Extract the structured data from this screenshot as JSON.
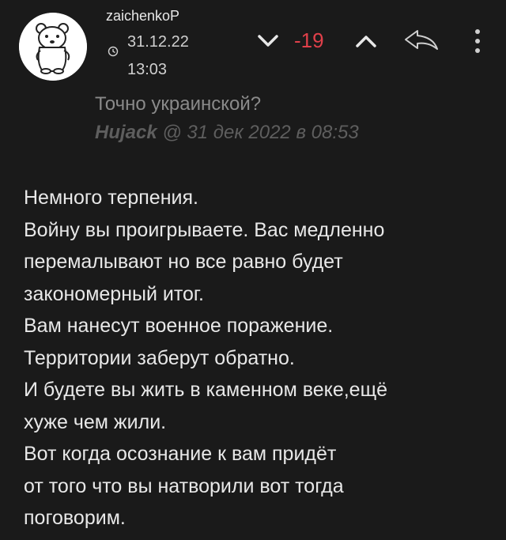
{
  "comment": {
    "username": "zaichenkoP",
    "date": "31.12.22",
    "time": "13:03",
    "score": "-19",
    "icons": {
      "avatar": "polar-bear-avatar",
      "clock": "clock-icon",
      "downvote": "chevron-down-icon",
      "upvote": "chevron-up-icon",
      "reply": "reply-arrow-icon",
      "more": "more-vertical-icon"
    },
    "colors": {
      "score": "#e0404a",
      "background": "#1a1a1a"
    }
  },
  "quote": {
    "text": "Точно украинской?",
    "author": "Hujack",
    "meta": " @ 31 дек 2022 в 08:53"
  },
  "body": {
    "lines": [
      "Немного терпения.",
      "Войну вы проигрываете. Вас медленно",
      "перемалывают но все равно будет",
      "закономерный итог.",
      "Вам нанесут военное поражение.",
      "Территории заберут обратно.",
      "И будете вы жить в каменном веке,ещё",
      "хуже чем жили.",
      "Вот когда осознание к вам придёт",
      "от того что вы натворили вот тогда",
      "поговорим."
    ]
  }
}
